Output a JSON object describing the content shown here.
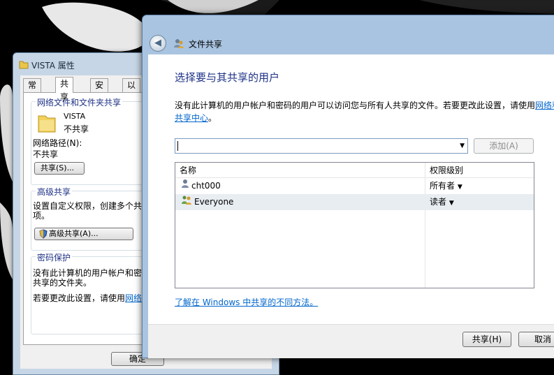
{
  "properties_dialog": {
    "title": "VISTA 属性",
    "tabs": [
      "常规",
      "共享",
      "安全",
      "以前"
    ],
    "network_group": {
      "title": "网络文件和文件夹共享",
      "folder_name": "VISTA",
      "folder_status": "不共享",
      "path_label": "网络路径(N):",
      "path_value": "不共享",
      "share_button": "共享(S)..."
    },
    "advanced_group": {
      "title": "高级共享",
      "desc_line1": "设置自定义权限，创建多个共",
      "desc_line2": "项。",
      "button": "高级共享(A)..."
    },
    "password_group": {
      "title": "密码保护",
      "desc_line1": "没有此计算机的用户帐户和密",
      "desc_line2": "共享的文件夹。",
      "change_text": "若要更改此设置，请使用",
      "change_link": "网络"
    },
    "ok_button": "确定"
  },
  "share_dialog": {
    "window_title": "文件共享",
    "heading": "选择要与其共享的用户",
    "description_line1": "没有此计算机的用户帐户和密码的用户可以访问您与所有人共享的文件。若要更改此设置，请使用",
    "description_link1": "网络和",
    "description_link2": "共享中心",
    "description_end": "。",
    "combo_value": "",
    "add_button": "添加(A)",
    "columns": [
      "名称",
      "权限级别"
    ],
    "rows": [
      {
        "name": "cht000",
        "permission": "所有者"
      },
      {
        "name": "Everyone",
        "permission": "读者"
      }
    ],
    "help_link": "了解在 Windows 中共享的不同方法。",
    "share_button": "共享(H)",
    "cancel_button": "取消"
  }
}
